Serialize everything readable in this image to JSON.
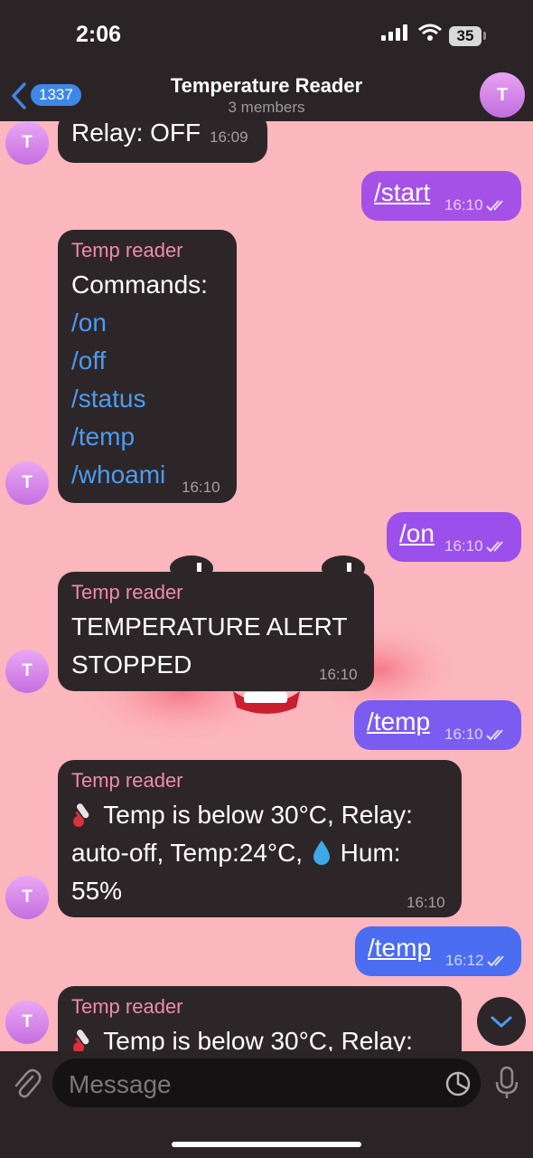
{
  "status_bar": {
    "time": "2:06",
    "battery": "35"
  },
  "header": {
    "back_count": "1337",
    "title": "Temperature Reader",
    "subtitle": "3 members",
    "avatar_letter": "T"
  },
  "messages": {
    "m0": {
      "text": "Relay: OFF",
      "time": "16:09",
      "avatar": "T"
    },
    "m1": {
      "text": "/start",
      "time": "16:10"
    },
    "m2": {
      "sender": "Temp reader",
      "heading": "Commands:",
      "commands": [
        "/on",
        "/off",
        "/status",
        "/temp",
        "/whoami"
      ],
      "time": "16:10",
      "avatar": "T"
    },
    "m3": {
      "text": "/on",
      "time": "16:10"
    },
    "m4": {
      "sender": "Temp reader",
      "lines": [
        "TEMPERATURE ALERT",
        "STOPPED"
      ],
      "time": "16:10",
      "avatar": "T"
    },
    "m5": {
      "text": "/temp",
      "time": "16:10"
    },
    "m6": {
      "sender": "Temp reader",
      "line1": "Temp is below 30°C, Relay:",
      "line2a": "auto-off, Temp:24°C,",
      "line2b": "Hum:",
      "line3": "55%",
      "time": "16:10",
      "avatar": "T"
    },
    "m7": {
      "text": "/temp",
      "time": "16:12"
    },
    "m8": {
      "sender": "Temp reader",
      "line1": "Temp is below 30°C, Relay:",
      "avatar": "T"
    }
  },
  "composer": {
    "placeholder": "Message"
  },
  "colors": {
    "chat_bg": "#fcb6bd",
    "incoming_bubble": "#2d2628",
    "sender_name": "#f089b0",
    "command_link": "#4c9bf0",
    "outgoing_top": "#a04fe8",
    "outgoing_bottom": "#3f6ff2"
  }
}
